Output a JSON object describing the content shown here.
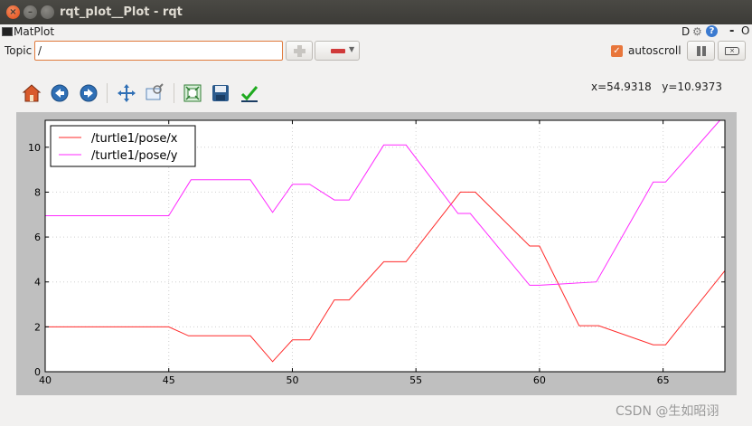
{
  "window": {
    "title": "rqt_plot__Plot - rqt"
  },
  "header": {
    "plugin_label": "MatPlot",
    "d_label": "D",
    "help_label": "?",
    "dash": "-",
    "o_label": "O"
  },
  "topic": {
    "label": "Topic",
    "value": "/"
  },
  "autoscroll": {
    "label": "autoscroll",
    "checked": true
  },
  "toolbar": {
    "icons": [
      "home-icon",
      "back-icon",
      "forward-icon",
      "pan-icon",
      "zoom-icon",
      "subplots-icon",
      "save-icon",
      "edit-curves-icon"
    ]
  },
  "coords": {
    "x_text": "x=54.9318",
    "y_text": "y=10.9373"
  },
  "watermark": "CSDN @生如昭诩",
  "colors": {
    "series_x": "#ff2a2a",
    "series_y": "#ff2aff",
    "accent": "#e8763b"
  },
  "chart_data": {
    "type": "line",
    "xlim": [
      40,
      67.5
    ],
    "ylim": [
      0,
      11.2
    ],
    "xticks": [
      40,
      45,
      50,
      55,
      60,
      65
    ],
    "yticks": [
      0,
      2,
      4,
      6,
      8,
      10
    ],
    "grid": true,
    "legend_position": "top-left",
    "series": [
      {
        "name": "/turtle1/pose/x",
        "color": "#ff2a2a",
        "x": [
          40,
          45,
          45.8,
          48.3,
          49.2,
          50,
          50.7,
          51.7,
          52.3,
          53.7,
          54.6,
          56.8,
          57.4,
          59.6,
          60,
          61.6,
          62.4,
          64.6,
          65.1,
          67.5
        ],
        "y": [
          2.0,
          2.0,
          1.6,
          1.6,
          0.45,
          1.42,
          1.42,
          3.2,
          3.2,
          4.9,
          4.9,
          8.0,
          8.0,
          5.6,
          5.6,
          2.05,
          2.05,
          1.2,
          1.2,
          4.5
        ]
      },
      {
        "name": "/turtle1/pose/y",
        "color": "#ff2aff",
        "x": [
          40,
          45,
          45.9,
          48.3,
          49.2,
          50,
          50.7,
          51.7,
          52.3,
          53.7,
          54.6,
          56.7,
          57.2,
          59.6,
          60,
          62.3,
          64.6,
          65.1,
          67.3
        ],
        "y": [
          6.95,
          6.95,
          8.55,
          8.55,
          7.1,
          8.35,
          8.35,
          7.65,
          7.65,
          10.1,
          10.1,
          7.05,
          7.05,
          3.85,
          3.85,
          4.0,
          8.45,
          8.45,
          11.2
        ]
      }
    ]
  }
}
